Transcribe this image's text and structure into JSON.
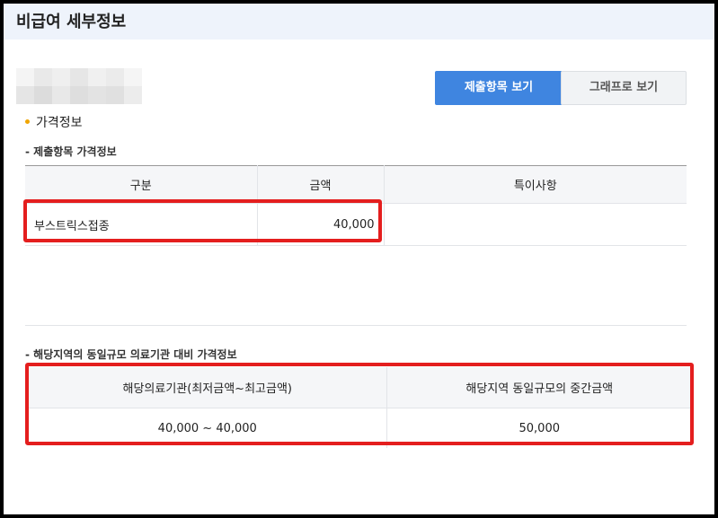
{
  "header": {
    "title": "비급여 세부정보"
  },
  "tabs": [
    {
      "label": "제출항목 보기",
      "active": true
    },
    {
      "label": "그래프로 보기",
      "active": false
    }
  ],
  "section_title": "가격정보",
  "submitted_section": {
    "title": "- 제출항목 가격정보",
    "columns": [
      "구분",
      "금액",
      "특이사항"
    ],
    "rows": [
      {
        "name": "부스트릭스접종",
        "amount": "40,000",
        "note": ""
      }
    ]
  },
  "regional_section": {
    "title": "- 해당지역의 동일규모 의료기관 대비 가격정보",
    "columns": [
      "해당의료기관(최저금액~최고금액)",
      "해당지역 동일규모의 중간금액"
    ],
    "values": [
      "40,000 ~ 40,000",
      "50,000"
    ]
  },
  "colors": {
    "accent": "#3f85e0",
    "highlight": "#e41e1e",
    "bullet": "#f0a500"
  }
}
